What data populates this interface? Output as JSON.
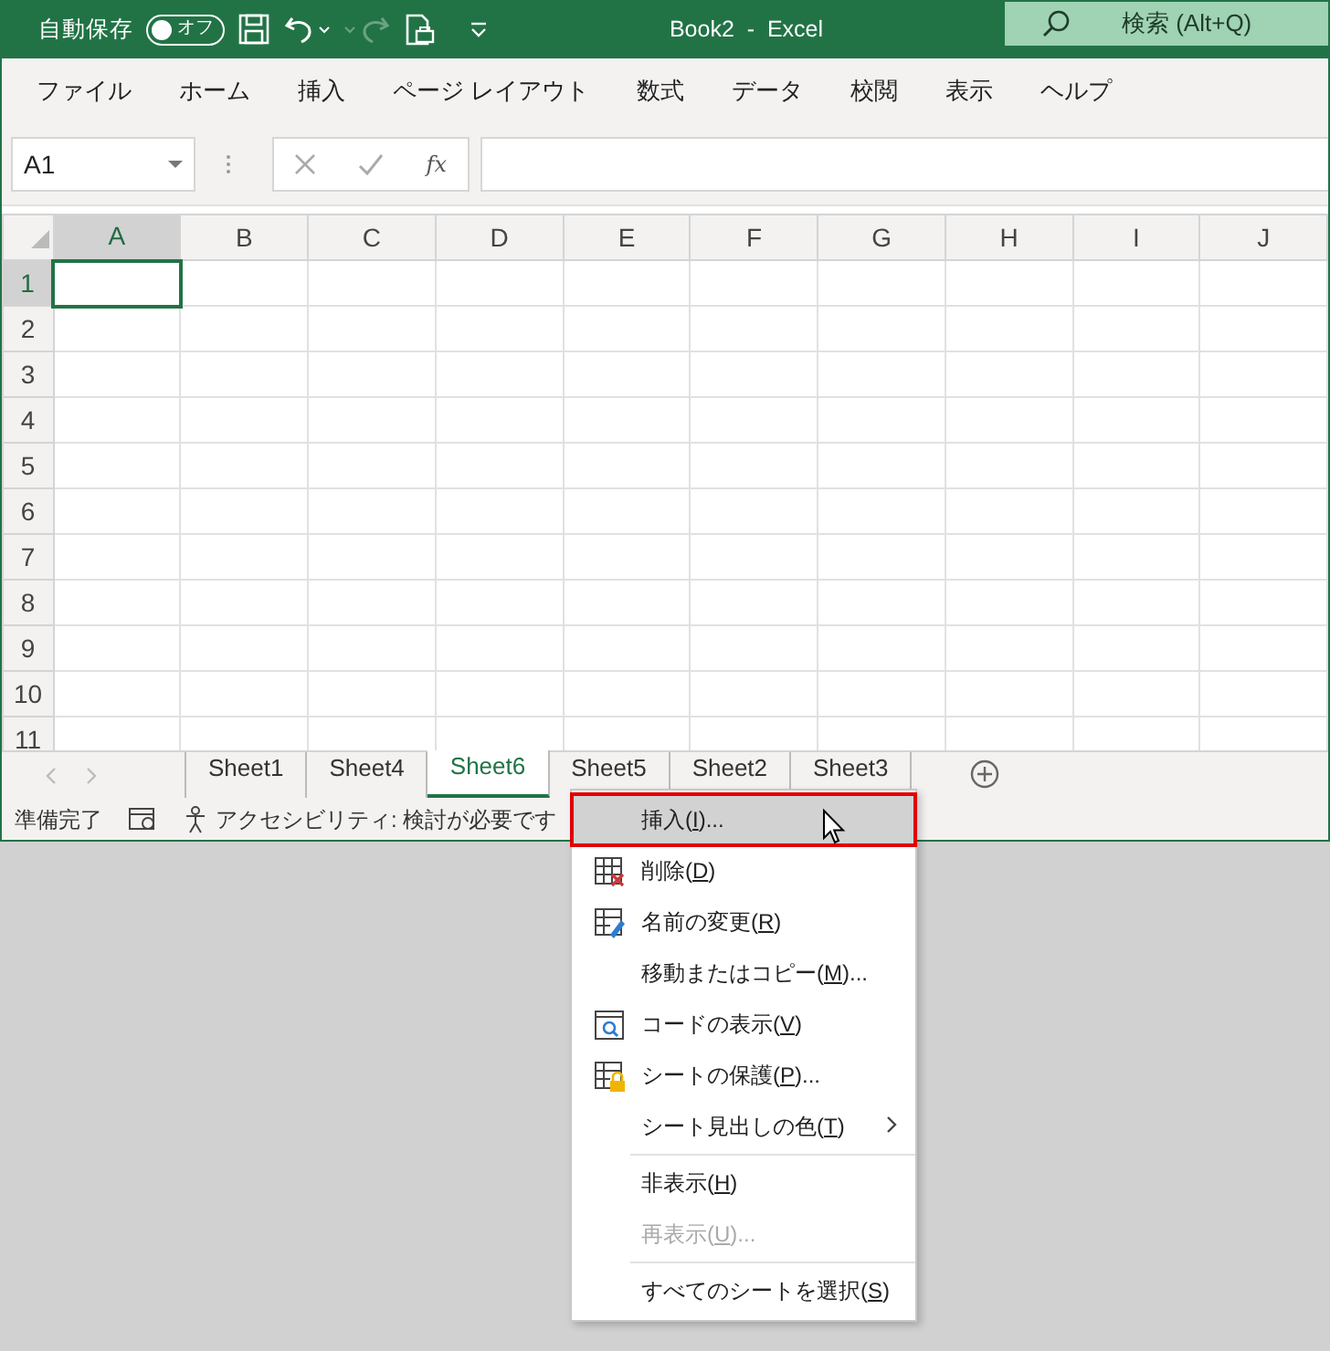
{
  "title_bar": {
    "autosave_label": "自動保存",
    "autosave_toggle": {
      "label": "オフ",
      "on": false
    },
    "redo_disabled": true,
    "title": "Book2  -  Excel",
    "search_placeholder": "検索 (Alt+Q)"
  },
  "ribbon_tabs": [
    {
      "label": "ファイル",
      "selected": false
    },
    {
      "label": "ホーム",
      "selected": false
    },
    {
      "label": "挿入",
      "selected": false
    },
    {
      "label": "ページ レイアウト",
      "selected": false
    },
    {
      "label": "数式",
      "selected": false
    },
    {
      "label": "データ",
      "selected": false
    },
    {
      "label": "校閲",
      "selected": false
    },
    {
      "label": "表示",
      "selected": false
    },
    {
      "label": "ヘルプ",
      "selected": false
    }
  ],
  "formula_bar": {
    "name_box": "A1",
    "function_label": "fx"
  },
  "sheet": {
    "columns": [
      {
        "label": "A",
        "selected": true
      },
      {
        "label": "B",
        "selected": false
      },
      {
        "label": "C",
        "selected": false
      },
      {
        "label": "D",
        "selected": false
      },
      {
        "label": "E",
        "selected": false
      },
      {
        "label": "F",
        "selected": false
      },
      {
        "label": "G",
        "selected": false
      },
      {
        "label": "H",
        "selected": false
      },
      {
        "label": "I",
        "selected": false
      },
      {
        "label": "J",
        "selected": false
      }
    ],
    "rows": [
      {
        "label": "1",
        "selected": true
      },
      {
        "label": "2",
        "selected": false
      },
      {
        "label": "3",
        "selected": false
      },
      {
        "label": "4",
        "selected": false
      },
      {
        "label": "5",
        "selected": false
      },
      {
        "label": "6",
        "selected": false
      },
      {
        "label": "7",
        "selected": false
      },
      {
        "label": "8",
        "selected": false
      },
      {
        "label": "9",
        "selected": false
      },
      {
        "label": "10",
        "selected": false
      },
      {
        "label": "11",
        "selected": false
      }
    ]
  },
  "sheet_tabs": [
    {
      "label": "Sheet1",
      "selected": false
    },
    {
      "label": "Sheet4",
      "selected": false
    },
    {
      "label": "Sheet6",
      "selected": true
    },
    {
      "label": "Sheet5",
      "selected": false
    },
    {
      "label": "Sheet2",
      "selected": false
    },
    {
      "label": "Sheet3",
      "selected": false
    }
  ],
  "status_bar": {
    "ready": "準備完了",
    "accessibility": "アクセシビリティ: 検討が必要です"
  },
  "context_menu": [
    {
      "kind": "plain",
      "label": "挿入(I)...",
      "selected": true,
      "disabled": false,
      "submenu": false
    },
    {
      "kind": "delete",
      "label": "削除(D)",
      "selected": false,
      "disabled": false,
      "submenu": false
    },
    {
      "kind": "rename",
      "label": "名前の変更(R)",
      "selected": false,
      "disabled": false,
      "submenu": false
    },
    {
      "kind": "plain",
      "label": "移動またはコピー(M)...",
      "selected": false,
      "disabled": false,
      "submenu": false
    },
    {
      "kind": "code",
      "label": "コードの表示(V)",
      "selected": false,
      "disabled": false,
      "submenu": false
    },
    {
      "kind": "protect",
      "label": "シートの保護(P)...",
      "selected": false,
      "disabled": false,
      "submenu": false
    },
    {
      "kind": "plain",
      "label": "シート見出しの色(T)",
      "selected": false,
      "disabled": false,
      "submenu": true
    },
    {
      "kind": "separator"
    },
    {
      "kind": "plain",
      "label": "非表示(H)",
      "selected": false,
      "disabled": false,
      "submenu": false
    },
    {
      "kind": "plain",
      "label": "再表示(U)...",
      "selected": false,
      "disabled": true,
      "submenu": false
    },
    {
      "kind": "separator"
    },
    {
      "kind": "plain",
      "label": "すべてのシートを選択(S)",
      "selected": false,
      "disabled": false,
      "submenu": false
    }
  ]
}
